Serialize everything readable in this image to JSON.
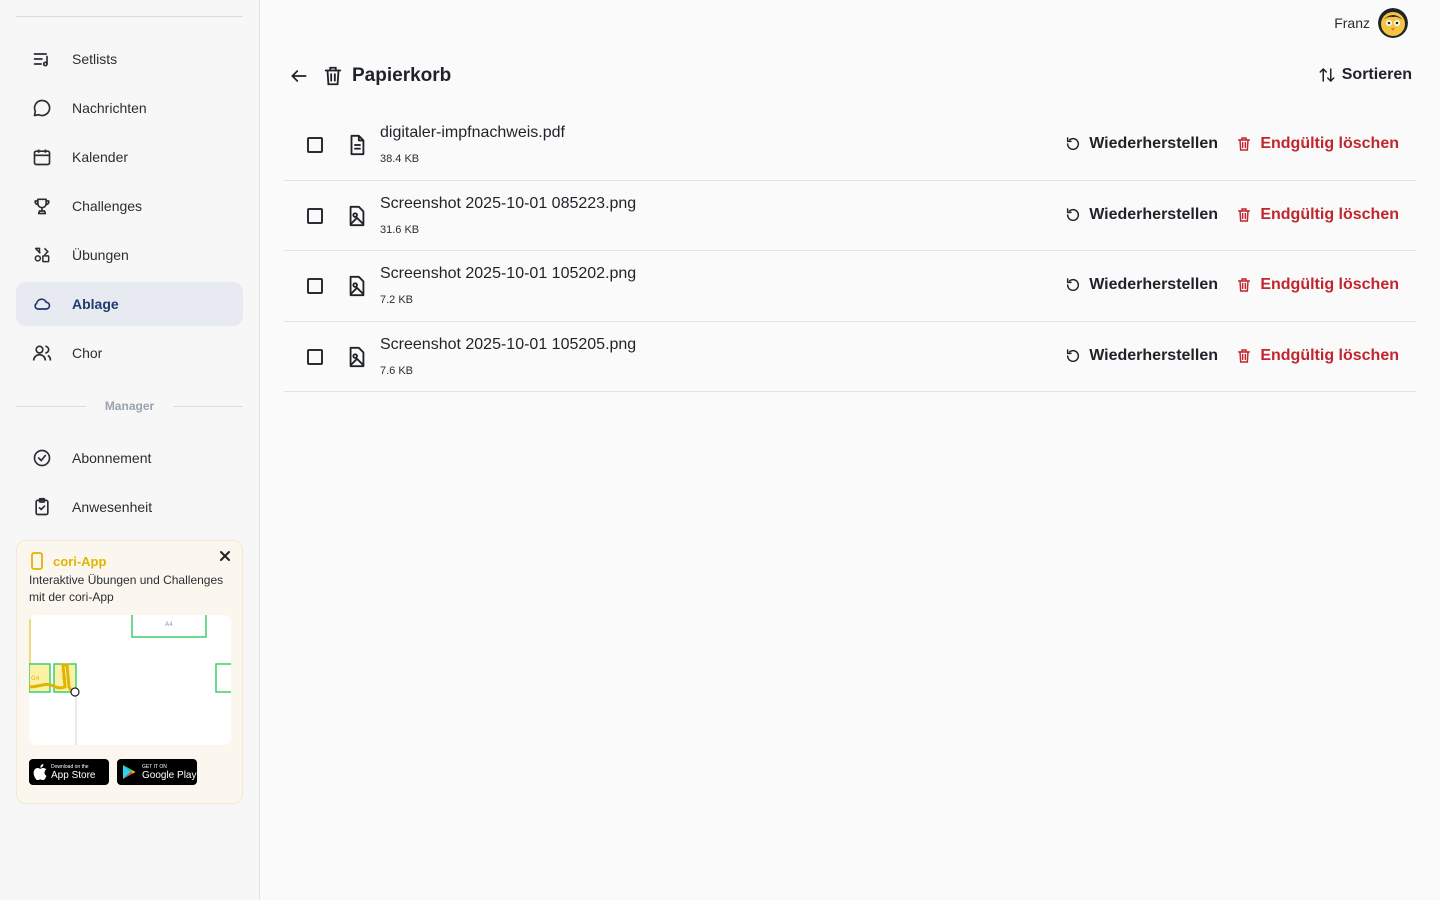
{
  "user": {
    "name": "Franz"
  },
  "sidebar": {
    "items": [
      {
        "label": "Setlists",
        "icon": "setlist-icon"
      },
      {
        "label": "Nachrichten",
        "icon": "message-icon"
      },
      {
        "label": "Kalender",
        "icon": "calendar-icon"
      },
      {
        "label": "Challenges",
        "icon": "trophy-icon"
      },
      {
        "label": "Übungen",
        "icon": "exercise-icon"
      },
      {
        "label": "Ablage",
        "icon": "cloud-icon",
        "active": true
      },
      {
        "label": "Chor",
        "icon": "users-icon"
      }
    ],
    "section_label": "Manager",
    "manager_items": [
      {
        "label": "Abonnement",
        "icon": "check-circle-icon"
      },
      {
        "label": "Anwesenheit",
        "icon": "clipboard-check-icon"
      }
    ],
    "promo": {
      "title": "cori-App",
      "description": "Interaktive Übungen und Challenges mit der cori-App",
      "appstore_small": "Download on the",
      "appstore_big": "App Store",
      "googleplay_small": "GET IT ON",
      "googleplay_big": "Google Play",
      "accent_color": "#e0b400"
    }
  },
  "page": {
    "title": "Papierkorb",
    "sort_label": "Sortieren",
    "restore_label": "Wiederherstellen",
    "delete_label": "Endgültig löschen",
    "danger_color": "#c0262d"
  },
  "files": [
    {
      "name": "digitaler-impfnachweis.pdf",
      "size": "38.4 KB",
      "icon": "document-icon"
    },
    {
      "name": "Screenshot 2025-10-01 085223.png",
      "size": "31.6 KB",
      "icon": "image-file-icon"
    },
    {
      "name": "Screenshot 2025-10-01 105202.png",
      "size": "7.2 KB",
      "icon": "image-file-icon"
    },
    {
      "name": "Screenshot 2025-10-01 105205.png",
      "size": "7.6 KB",
      "icon": "image-file-icon"
    }
  ]
}
